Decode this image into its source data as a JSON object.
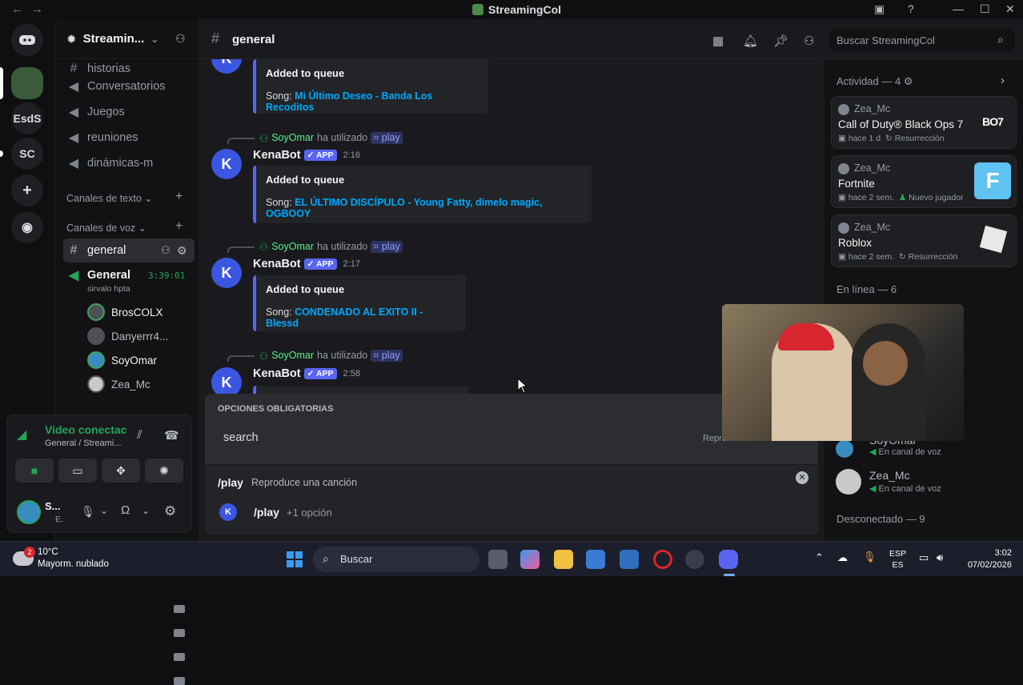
{
  "window": {
    "title": "StreamingCol"
  },
  "rail": {
    "servers": [
      "EsdS",
      "SC"
    ]
  },
  "sidebar": {
    "server_name": "Streamin...",
    "top_channels": [
      "historias",
      "Conversatorios",
      "Juegos",
      "reuniones",
      "dinámicas-m"
    ],
    "text_category": "Canales de texto",
    "voice_category": "Canales de voz",
    "active_channel": "general",
    "voice_channel": {
      "name": "General",
      "timer": "3:39:01",
      "status": "sirvalo hpta"
    },
    "voice_users": [
      "BrosCOLX",
      "Danyerrr4...",
      "SoyOmar",
      "Zea_Mc"
    ]
  },
  "voice_panel": {
    "status": "Video conectac",
    "location": "General / Streami...",
    "user_short": "S...",
    "user_sub": "E."
  },
  "header": {
    "channel": "general",
    "search_placeholder": "Buscar StreamingCol"
  },
  "messages": [
    {
      "embed_title": "Added to queue",
      "song_label": "Song: ",
      "song": "Mi Último Deseo - Banda Los Recoditos"
    },
    {
      "reply_user": "SoyOmar",
      "reply_text": "ha utilizado",
      "reply_cmd": "play",
      "author": "KenaBot",
      "badge": "✓ APP",
      "time": "2:16",
      "embed_title": "Added to queue",
      "song_label": "Song: ",
      "song": "EL ÚLTIMO DISCÍPULO - Young Fatty, dimelo magic, OGBOOY"
    },
    {
      "reply_user": "SoyOmar",
      "reply_text": "ha utilizado",
      "reply_cmd": "play",
      "author": "KenaBot",
      "badge": "✓ APP",
      "time": "2:17",
      "embed_title": "Added to queue",
      "song_label": "Song: ",
      "song": "CONDENADO AL EXITO II - Blessd"
    },
    {
      "reply_user": "SoyOmar",
      "reply_text": "ha utilizado",
      "reply_cmd": "play",
      "author": "KenaBot",
      "badge": "✓ APP",
      "time": "2:58"
    }
  ],
  "command_panel": {
    "section": "OPCIONES OBLIGATORIAS",
    "option": "search",
    "option_hint": "Repro",
    "command": "/play",
    "command_desc": "Reproduce una canción",
    "suggest_cmd": "/play",
    "suggest_extra": "+1 opción"
  },
  "activity": {
    "header": "Actividad — 4",
    "cards": [
      {
        "user": "Zea_Mc",
        "game": "Call of Duty® Black Ops 7",
        "time": "hace 1 d",
        "tag": "Resurrección",
        "art": "BO7"
      },
      {
        "user": "Zea_Mc",
        "game": "Fortnite",
        "time": "hace 2 sem.",
        "tag": "Nuevo jugador",
        "art": "F"
      },
      {
        "user": "Zea_Mc",
        "game": "Roblox",
        "time": "hace 2 sem.",
        "tag": "Resurrección",
        "art": ""
      }
    ],
    "online_header": "En línea — 6",
    "members": [
      {
        "name": "SoyOmar",
        "status": "En canal de voz"
      },
      {
        "name": "Zea_Mc",
        "status": "En canal de voz"
      }
    ],
    "offline_header": "Desconectado — 9"
  },
  "taskbar": {
    "weather_temp": "10°C",
    "weather_desc": "Mayorm. nublado",
    "weather_badge": "2",
    "search": "Buscar",
    "lang_top": "ESP",
    "lang_bottom": "ES",
    "time": "3:02",
    "date": "07/02/2026"
  }
}
